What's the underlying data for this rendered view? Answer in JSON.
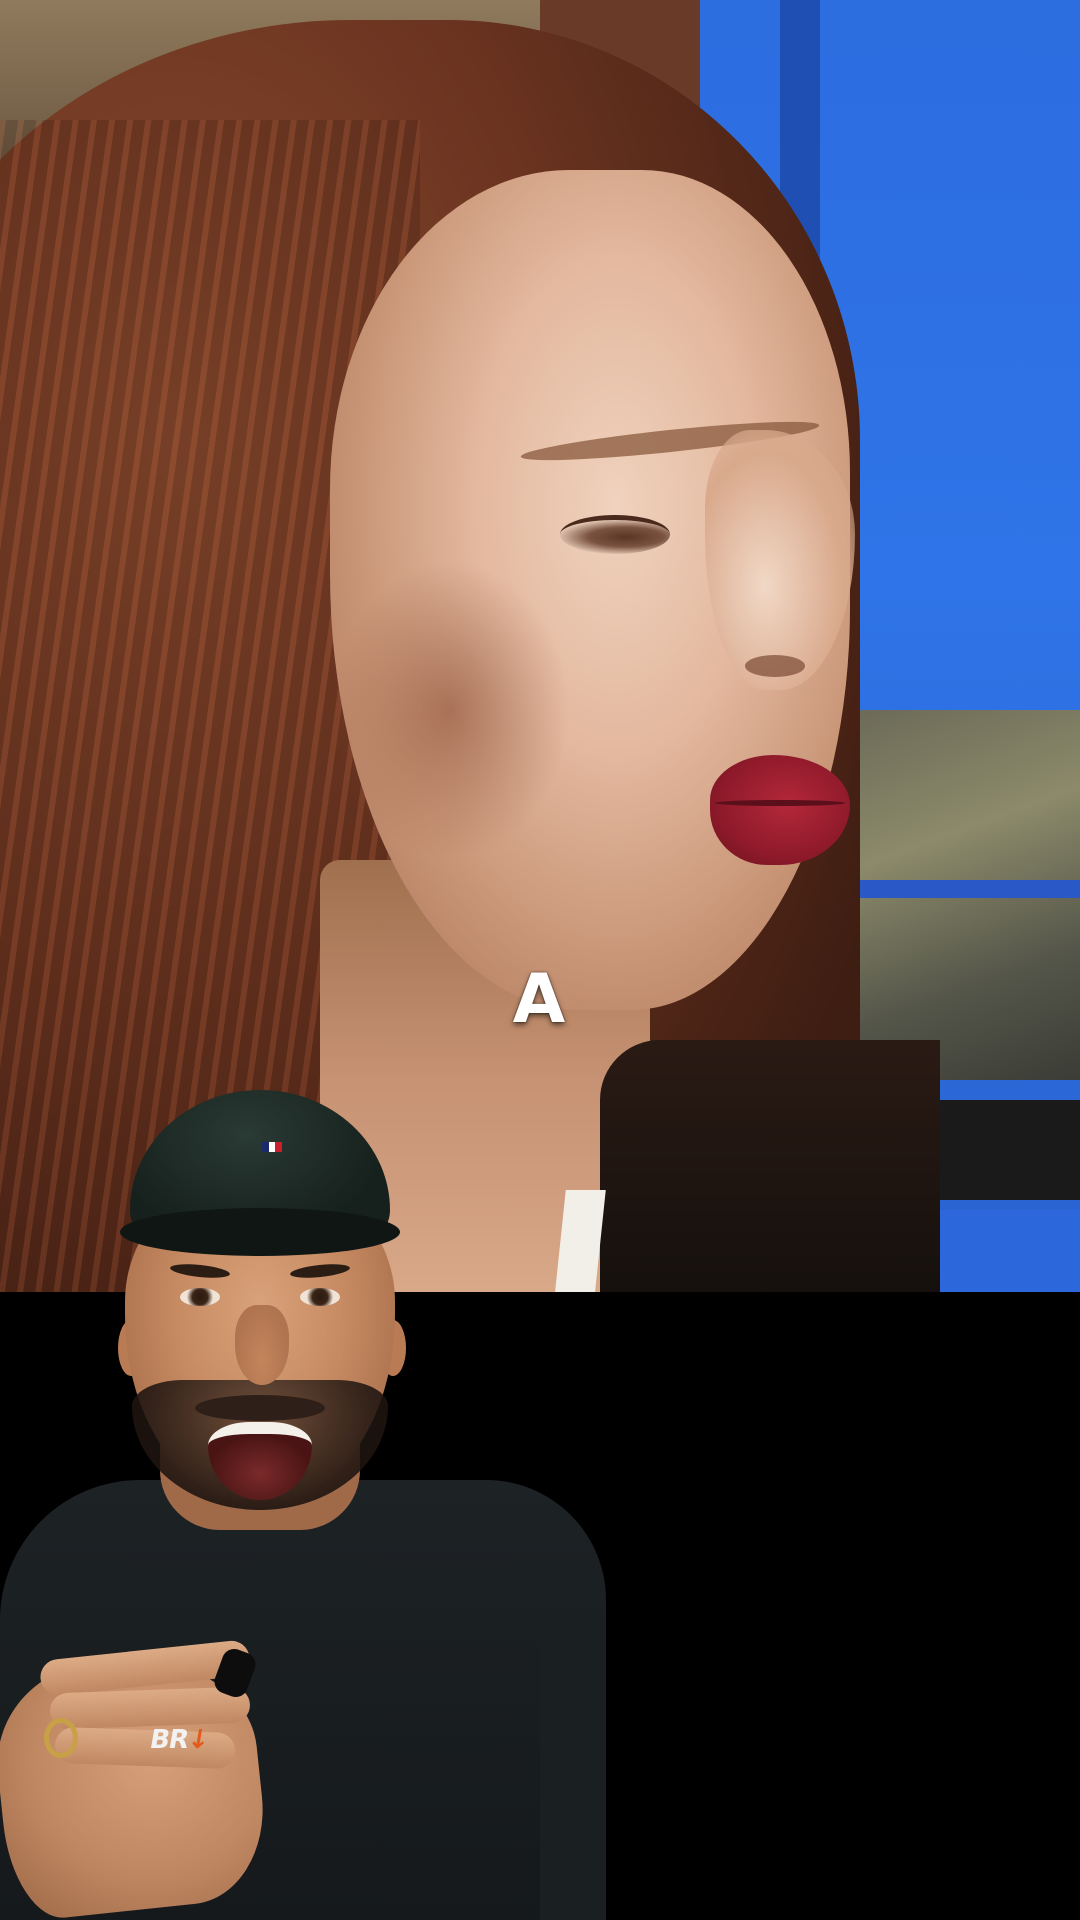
{
  "caption": {
    "text": "A"
  },
  "overlay": {
    "shirt_logo_text": "BR",
    "shirt_logo_accent": "↓"
  },
  "colors": {
    "wall_blue": "#2f74e8",
    "caption_color": "#ffffff",
    "bottom_background": "#000000",
    "lip_red": "#8f1a2a"
  },
  "icons": {
    "cap_logo": "flag-logo-icon",
    "device": "presentation-clicker-icon"
  }
}
